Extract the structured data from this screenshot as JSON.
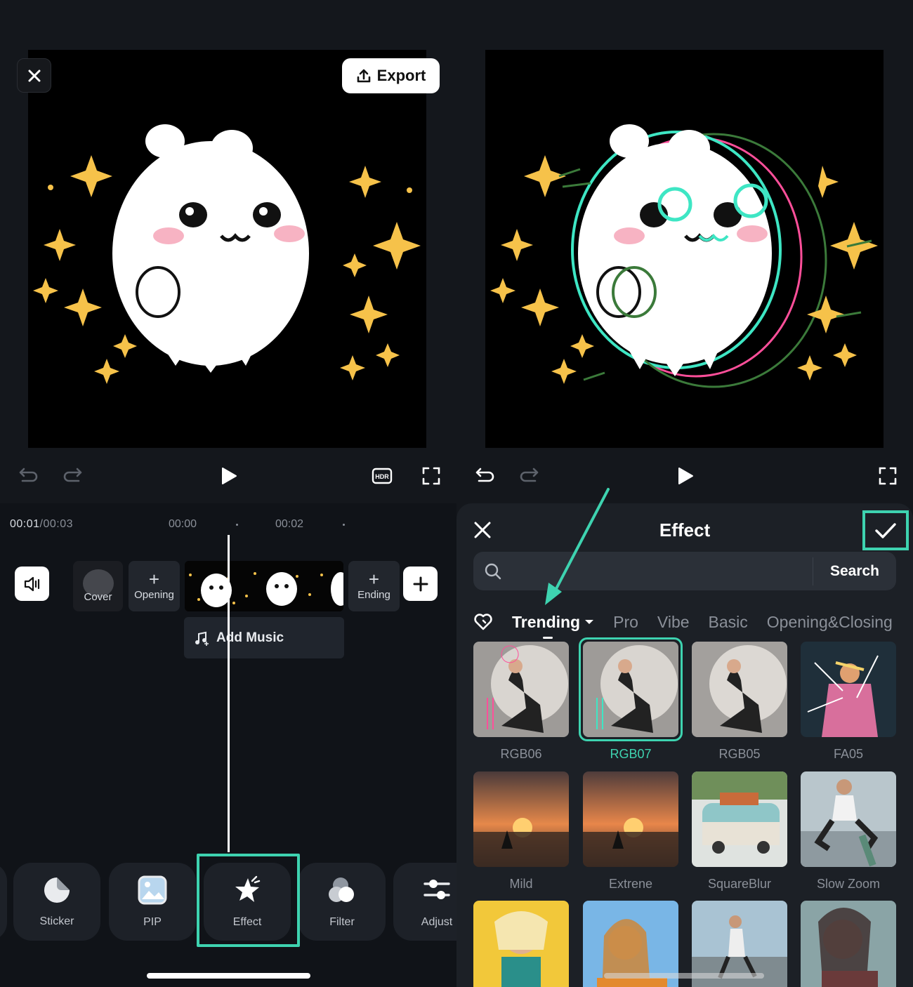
{
  "left_editor": {
    "export_label": "Export",
    "timeline": {
      "current_time": "00:01",
      "total_time": "/00:03",
      "ticks": [
        "00:00",
        "00:02"
      ],
      "cover_label": "Cover",
      "opening_label": "Opening",
      "ending_label": "Ending",
      "add_music_label": "Add Music"
    },
    "toolbar": [
      {
        "label": "Sticker",
        "icon": "sticker-icon"
      },
      {
        "label": "PIP",
        "icon": "pip-icon"
      },
      {
        "label": "Effect",
        "icon": "effect-icon",
        "selected": true
      },
      {
        "label": "Filter",
        "icon": "filter-icon"
      },
      {
        "label": "Adjust",
        "icon": "adjust-icon"
      }
    ]
  },
  "effect_panel": {
    "title": "Effect",
    "search_placeholder": "",
    "search_button": "Search",
    "categories": [
      "Trending",
      "Pro",
      "Vibe",
      "Basic",
      "Opening&Closing"
    ],
    "active_category": "Trending",
    "effects": [
      {
        "label": "RGB06"
      },
      {
        "label": "RGB07",
        "selected": true
      },
      {
        "label": "RGB05"
      },
      {
        "label": "FA05"
      },
      {
        "label": "Mild"
      },
      {
        "label": "Extrene"
      },
      {
        "label": "SquareBlur"
      },
      {
        "label": "Slow Zoom"
      }
    ]
  },
  "colors": {
    "accent": "#3ed3b0",
    "background": "#14171c",
    "sheet": "#1c2026"
  }
}
